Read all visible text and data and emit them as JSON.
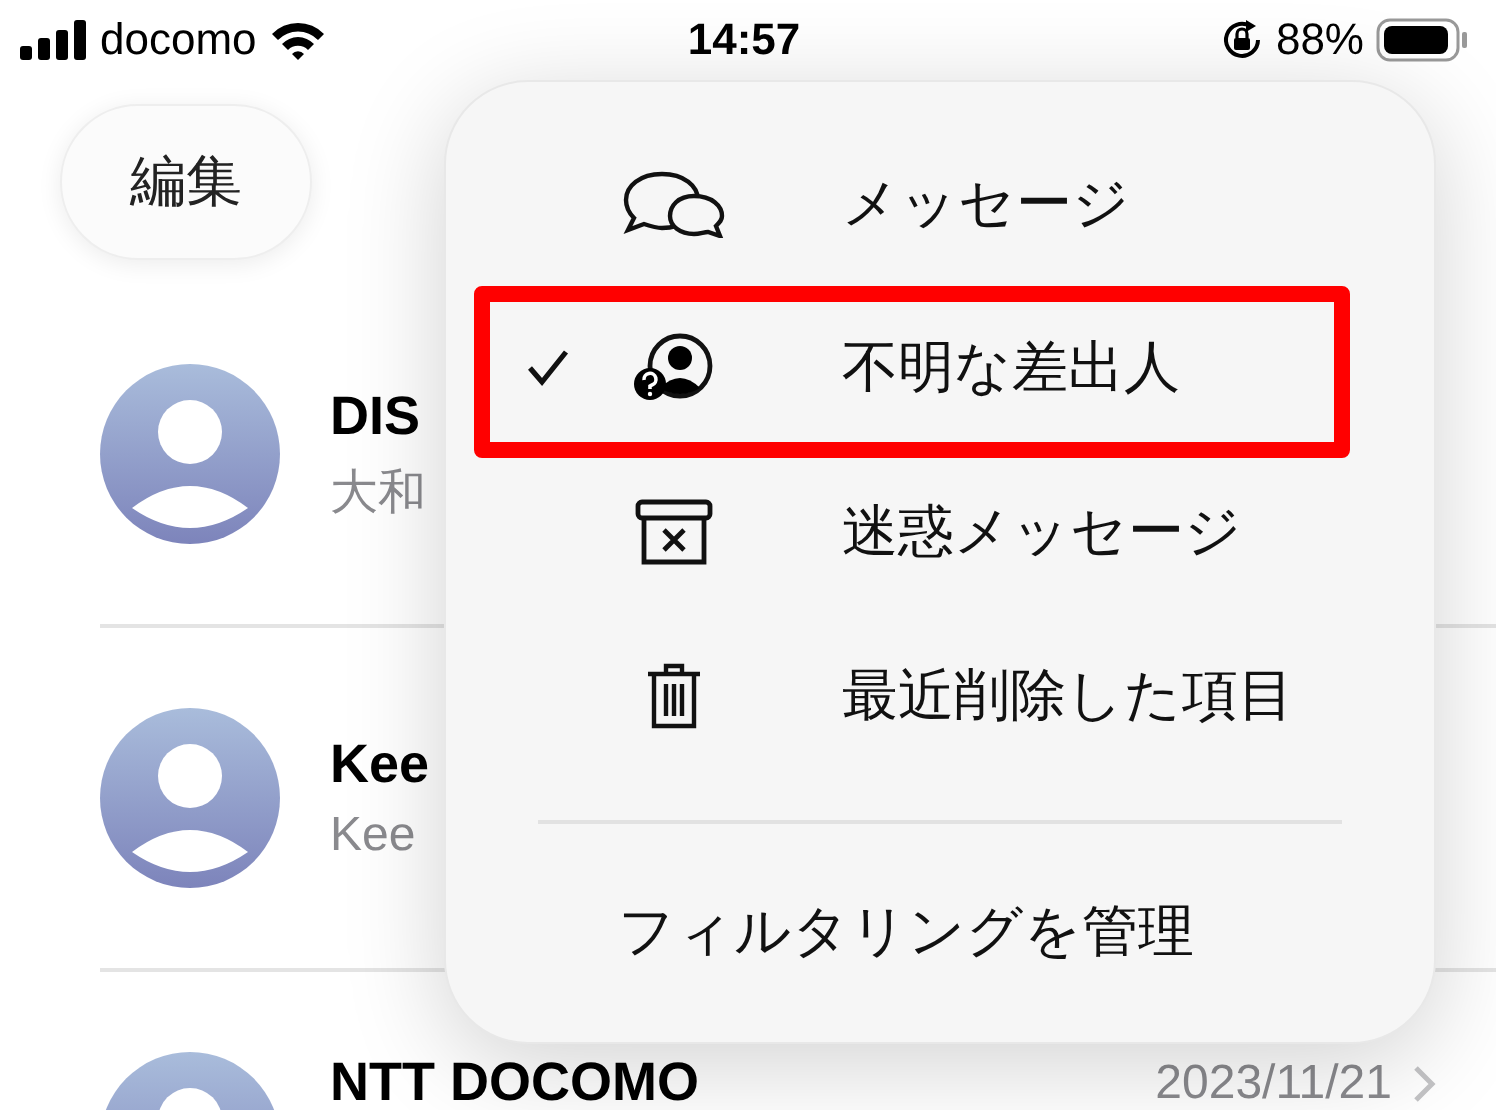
{
  "status_bar": {
    "carrier": "docomo",
    "time": "14:57",
    "battery": "88%"
  },
  "edit_button": "編集",
  "conversations": [
    {
      "name": "DIS",
      "preview": "大和"
    },
    {
      "name": "Kee",
      "preview": "Kee"
    },
    {
      "name": "NTT DOCOMO",
      "date": "2023/11/21"
    }
  ],
  "filter_menu": {
    "items": [
      {
        "label": "メッセージ",
        "checked": false,
        "highlighted": false
      },
      {
        "label": "不明な差出人",
        "checked": true,
        "highlighted": true
      },
      {
        "label": "迷惑メッセージ",
        "checked": false,
        "highlighted": false
      },
      {
        "label": "最近削除した項目",
        "checked": false,
        "highlighted": false
      }
    ],
    "footer": "フィルタリングを管理"
  }
}
